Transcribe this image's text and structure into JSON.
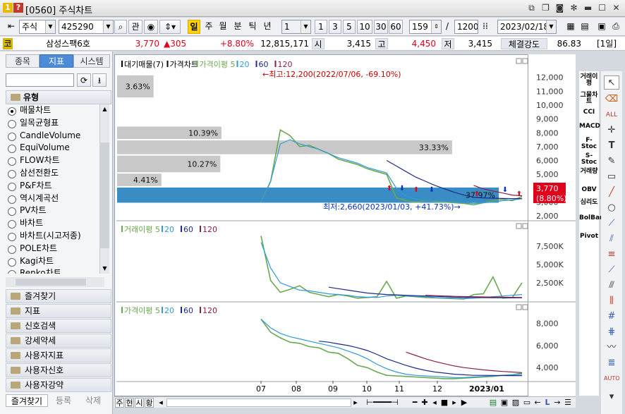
{
  "window": {
    "code": "[0560]",
    "title": "주식차트"
  },
  "toolbar": {
    "market": "주식",
    "stock_code": "425290",
    "btn_view": "관",
    "periods": [
      "일",
      "주",
      "월",
      "분",
      "틱",
      "년"
    ],
    "interval_value": "1",
    "intervals": [
      "1",
      "3",
      "5",
      "10",
      "30",
      "60"
    ],
    "count": "159",
    "separator": "/",
    "total": "1200",
    "date": "2023/02/18"
  },
  "quote": {
    "name_label": "코",
    "name": "삼성스팩6호",
    "price": "3,770",
    "change": "▲305",
    "change_pct": "+8.80%",
    "volume": "12,815,171",
    "open_label": "시",
    "open": "3,415",
    "high_label": "고",
    "high": "4,450",
    "low_label": "저",
    "low": "3,415",
    "strength_label": "체결강도",
    "strength": "86.83",
    "period_badge": "[1일]"
  },
  "left": {
    "tabs": [
      "종목",
      "지표",
      "시스템"
    ],
    "section": "유형",
    "chart_types": [
      "매물차트",
      "일목균형표",
      "CandleVolume",
      "EquiVolume",
      "FLOW차트",
      "삼선전환도",
      "P&F차트",
      "역시계곡선",
      "PV차트",
      "바차트",
      "바차트(시고저종)",
      "POLE차트",
      "Kagi차트",
      "Renko차트"
    ],
    "folders": [
      "즐겨찾기",
      "지표",
      "신호검색",
      "강세약세",
      "사용자지표",
      "사용자신호",
      "사용자강약"
    ],
    "bottom_tabs": [
      "즐겨찾기",
      "등록",
      "삭제"
    ]
  },
  "indicators": [
    "거래이평",
    "그물차트",
    "CCI",
    "MACD",
    "F-Stoc",
    "S-Stoc",
    "거래량",
    "OBV",
    "심리도",
    "BolBand",
    "Pivot"
  ],
  "bottombar": {
    "tabs": [
      "주",
      "현",
      "시",
      "황"
    ]
  },
  "colors": {
    "up": "#e0001b",
    "down": "#0030c8",
    "ma5": "#6aa84f",
    "ma20": "#2f9bd8",
    "ma60": "#1f2a8a",
    "ma120": "#8a1f4a",
    "volume_profile": "#c8c8c8",
    "volume_profile_current": "#2e86c1"
  },
  "chart_data": [
    {
      "type": "line",
      "legend": [
        "대기매물(7)",
        "가격차트",
        "가격이평 5",
        "20",
        "60",
        "120"
      ],
      "annotation_high": "←최고:12,200(2022/07/06, -69.10%)",
      "annotation_low": "최저:2,660(2023/01/03, +41.73%)→",
      "y_ticks": [
        "12,000",
        "11,000",
        "10,000",
        "9,000",
        "8,000",
        "7,000",
        "6,000",
        "5,000",
        "4,000",
        "3,000",
        "2,000"
      ],
      "ylim": [
        1700,
        12800
      ],
      "current_price": "3,770",
      "current_change": "(8.80%)",
      "x_ticks": [
        "07",
        "08",
        "09",
        "10",
        "11",
        "12",
        "2023/01"
      ],
      "volume_profile": [
        {
          "range": [
            10500,
            12200
          ],
          "pct": "3.63%"
        },
        {
          "range": [
            7500,
            8500
          ],
          "pct": "10.39%"
        },
        {
          "range": [
            6400,
            7500
          ],
          "pct": "33.33%"
        },
        {
          "range": [
            5100,
            6400
          ],
          "pct": "10.27%"
        },
        {
          "range": [
            4100,
            5100
          ],
          "pct": "4.41%"
        },
        {
          "range": [
            2900,
            4100
          ],
          "pct": "37.97%"
        }
      ],
      "series": [
        {
          "name": "가격이평 5",
          "values": [
            3000,
            4500,
            8200,
            7800,
            7000,
            7100,
            6800,
            6500,
            6100,
            5900,
            5700,
            5400,
            5200,
            5000,
            3300,
            3100,
            3000,
            3100,
            3050,
            3000,
            2950,
            2900,
            2800,
            2950,
            3100,
            3200,
            3100,
            3400
          ]
        },
        {
          "name": "20",
          "values": [
            3000,
            4500,
            7200,
            7500,
            7200,
            7000,
            6800,
            6500,
            6200,
            6000,
            5800,
            5500,
            5300,
            5100,
            4000,
            3400,
            3200,
            3100,
            3100,
            3050,
            3000,
            2950,
            2900,
            2950,
            3000,
            3100,
            3150,
            3250
          ]
        },
        {
          "name": "60",
          "values": [
            null,
            null,
            null,
            null,
            null,
            null,
            null,
            null,
            null,
            null,
            null,
            null,
            null,
            6000,
            5600,
            5200,
            4800,
            4500,
            4200,
            3950,
            3700,
            3500,
            3350,
            3300,
            3280,
            3260,
            3250,
            3250
          ]
        },
        {
          "name": "120",
          "values": [
            null,
            null,
            null,
            null,
            null,
            null,
            null,
            null,
            null,
            null,
            null,
            null,
            null,
            null,
            null,
            null,
            null,
            null,
            null,
            null,
            null,
            null,
            4200,
            3950,
            3800,
            3650,
            3500,
            3450
          ]
        }
      ]
    },
    {
      "type": "line",
      "legend": [
        "거래이평 5",
        "20",
        "60",
        "120"
      ],
      "y_ticks": [
        "7,500K",
        "5,000K",
        "2,500K"
      ],
      "ylim": [
        0,
        9500
      ],
      "series": [
        {
          "name": "거래이평 5",
          "values": [
            8900,
            2800,
            1200,
            1600,
            2100,
            1200,
            900,
            600,
            900,
            700,
            400,
            500,
            600,
            2700,
            400,
            700,
            600,
            500,
            450,
            400,
            350,
            300,
            900,
            1000,
            3300,
            400,
            500,
            2500
          ]
        },
        {
          "name": "20",
          "values": [
            8000,
            4500,
            2500,
            2000,
            1500,
            1400,
            1200,
            1000,
            900,
            800,
            600,
            550,
            500,
            700,
            800,
            700,
            650,
            600,
            500,
            450,
            400,
            350,
            400,
            500,
            600,
            700,
            800,
            900
          ]
        },
        {
          "name": "60",
          "values": [
            null,
            null,
            null,
            null,
            null,
            null,
            null,
            1900,
            1700,
            1500,
            1300,
            1100,
            1000,
            900,
            850,
            800,
            750,
            700,
            650,
            600,
            550,
            500,
            500,
            480,
            470,
            460,
            450,
            460
          ]
        },
        {
          "name": "120",
          "values": [
            null,
            null,
            null,
            null,
            null,
            null,
            null,
            null,
            null,
            null,
            null,
            null,
            null,
            null,
            null,
            null,
            null,
            800,
            750,
            700,
            650,
            620,
            600,
            580,
            560,
            540,
            520,
            510
          ]
        }
      ]
    },
    {
      "type": "line",
      "legend": [
        "가격이평 5",
        "20",
        "60",
        "120"
      ],
      "y_ticks": [
        "8,000",
        "6,000",
        "4,000"
      ],
      "ylim": [
        2800,
        9000
      ],
      "series": [
        {
          "name": "가격이평 5",
          "values": [
            8400,
            7200,
            6700,
            6300,
            6200,
            5900,
            5800,
            5400,
            5300,
            4800,
            4200,
            4000,
            3600,
            3300,
            3250,
            3200,
            3150,
            3100,
            3050,
            3000,
            3000,
            3050,
            3100,
            3150,
            3200,
            3300,
            3350,
            3500
          ]
        },
        {
          "name": "20",
          "values": [
            8400,
            7600,
            7100,
            6800,
            6600,
            6400,
            6200,
            6000,
            5800,
            5500,
            5200,
            4800,
            4300,
            3900,
            3600,
            3400,
            3300,
            3250,
            3200,
            3150,
            3100,
            3100,
            3150,
            3200,
            3250,
            3300,
            3350,
            3400
          ]
        },
        {
          "name": "60",
          "values": [
            null,
            null,
            null,
            null,
            null,
            null,
            6400,
            6300,
            6150,
            6000,
            5800,
            5550,
            5200,
            4800,
            4500,
            4200,
            3950,
            3750,
            3600,
            3500,
            3400,
            3350,
            3300,
            3300,
            3290,
            3280,
            3270,
            3270
          ]
        },
        {
          "name": "120",
          "values": [
            null,
            null,
            null,
            null,
            null,
            null,
            null,
            null,
            null,
            null,
            null,
            null,
            null,
            null,
            null,
            5400,
            5100,
            4800,
            4550,
            4350,
            4150,
            4000,
            3900,
            3800,
            3720,
            3650,
            3600,
            3550
          ]
        }
      ]
    }
  ]
}
